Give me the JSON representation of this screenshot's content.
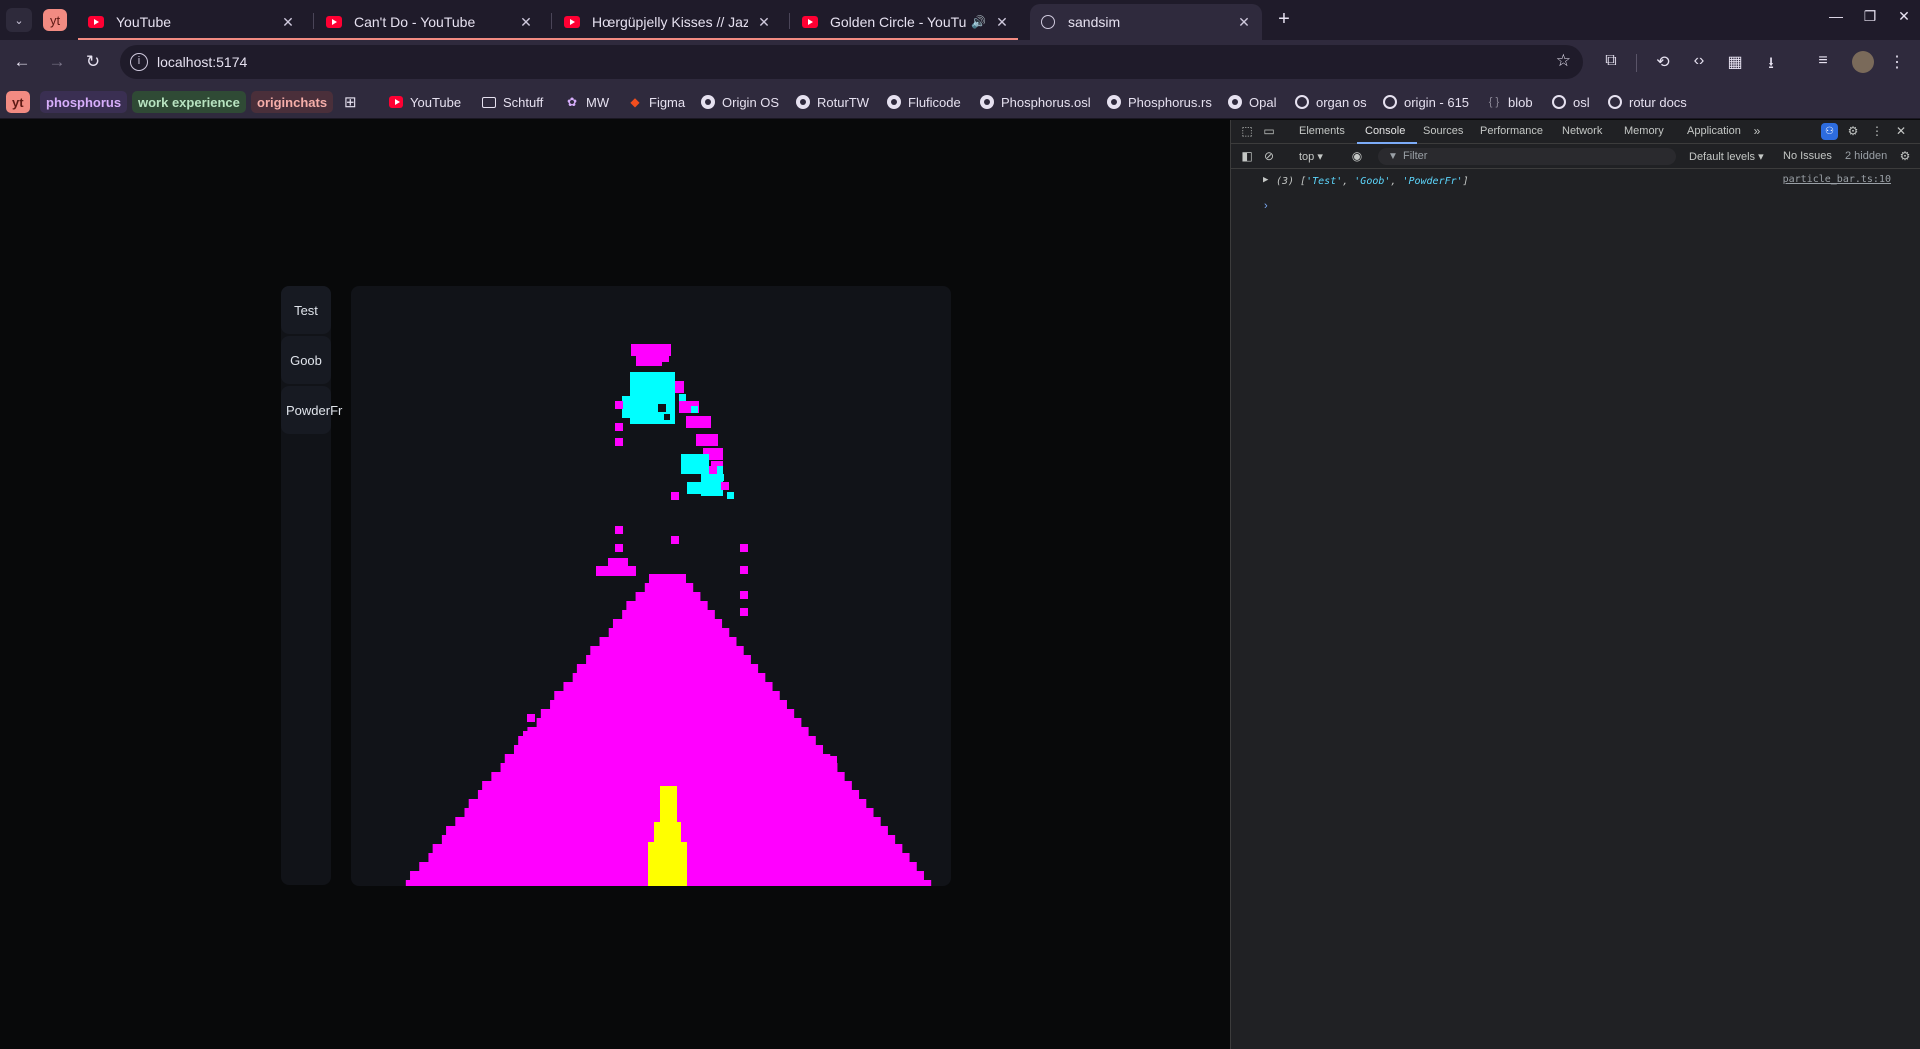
{
  "browser": {
    "tab_group_label": "yt",
    "tabs": [
      {
        "title": "YouTube",
        "favicon": "youtube-icon"
      },
      {
        "title": "Can't Do - YouTube",
        "favicon": "youtube-icon"
      },
      {
        "title": "Hœrgüpjelly Kisses // Jazz En",
        "favicon": "youtube-icon"
      },
      {
        "title": "Golden Circle - YouTube",
        "favicon": "youtube-icon",
        "audio": "🔊"
      },
      {
        "title": "sandsim",
        "favicon": "globe-icon",
        "active": true
      }
    ],
    "url": "localhost:5174"
  },
  "bookmarks": {
    "chips": [
      {
        "label": "yt",
        "color": "#f28b82",
        "text_color": "#5d1a14"
      },
      {
        "label": "phosphorus",
        "color": "#3a2f52",
        "text_color": "#d7aefb"
      },
      {
        "label": "work experience",
        "color": "#2f4a35",
        "text_color": "#b7e3c0"
      },
      {
        "label": "originchats",
        "color": "#4a2f3a",
        "text_color": "#f6aea9"
      }
    ],
    "items": [
      {
        "label": "YouTube",
        "icon": "youtube-icon"
      },
      {
        "label": "Schtuff",
        "icon": "folder-icon"
      },
      {
        "label": "MW",
        "icon": "mw-icon"
      },
      {
        "label": "Figma",
        "icon": "figma-icon"
      },
      {
        "label": "Origin OS",
        "icon": "github-icon"
      },
      {
        "label": "RoturTW",
        "icon": "github-icon"
      },
      {
        "label": "Fluficode",
        "icon": "github-icon"
      },
      {
        "label": "Phosphorus.osl",
        "icon": "github-icon"
      },
      {
        "label": "Phosphorus.rs",
        "icon": "github-icon"
      },
      {
        "label": "Opal",
        "icon": "github-icon"
      },
      {
        "label": "organ os",
        "icon": "origin-icon"
      },
      {
        "label": "origin - 615",
        "icon": "origin-icon"
      },
      {
        "label": "blob",
        "icon": "code-icon"
      },
      {
        "label": "osl",
        "icon": "origin-icon"
      },
      {
        "label": "rotur docs",
        "icon": "origin-icon"
      }
    ]
  },
  "app": {
    "particles": [
      "Test",
      "Goob",
      "PowderFr"
    ],
    "colors": {
      "powder": "#ff00ff",
      "goob": "#00ffff",
      "test": "#ffff00",
      "canvas_bg": "#111318"
    }
  },
  "devtools": {
    "tabs": [
      "Elements",
      "Console",
      "Sources",
      "Performance",
      "Network",
      "Memory",
      "Application"
    ],
    "active_tab": "Console",
    "context": "top",
    "filter_placeholder": "Filter",
    "levels": "Default levels",
    "issues": "No Issues",
    "hidden": "2 hidden",
    "console": {
      "count": "(3)",
      "values": [
        "'Test'",
        "'Goob'",
        "'PowderFr'"
      ],
      "source": "particle_bar.ts:10"
    }
  }
}
